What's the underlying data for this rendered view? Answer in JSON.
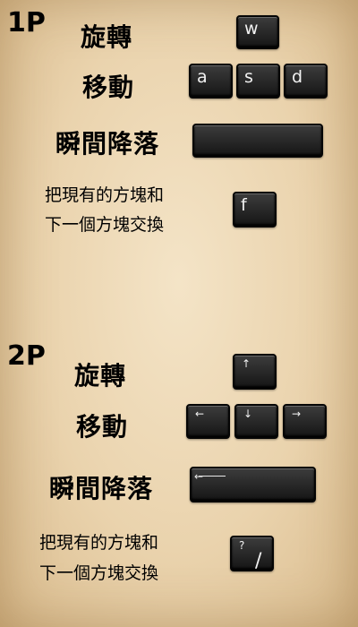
{
  "p1": {
    "title": "1P",
    "rotate": {
      "label": "旋轉",
      "key": "w"
    },
    "move": {
      "label": "移動",
      "keys": [
        "a",
        "s",
        "d"
      ]
    },
    "drop": {
      "label": "瞬間降落",
      "key": ""
    },
    "swap": {
      "label_line1": "把現有的方塊和",
      "label_line2": "下一個方塊交換",
      "key": "f"
    }
  },
  "p2": {
    "title": "2P",
    "rotate": {
      "label": "旋轉",
      "key": "↑"
    },
    "move": {
      "label": "移動",
      "keys": [
        "←",
        "↓",
        "→"
      ]
    },
    "drop": {
      "label": "瞬間降落",
      "key_symbol": "←"
    },
    "swap": {
      "label_line1": "把現有的方塊和",
      "label_line2": "下一個方塊交換",
      "key_top": "?",
      "key_bottom": "/"
    }
  },
  "colors": {
    "background": "#ead3ad",
    "key": "#1f1f1f",
    "key_text": "#f2f2f2"
  }
}
